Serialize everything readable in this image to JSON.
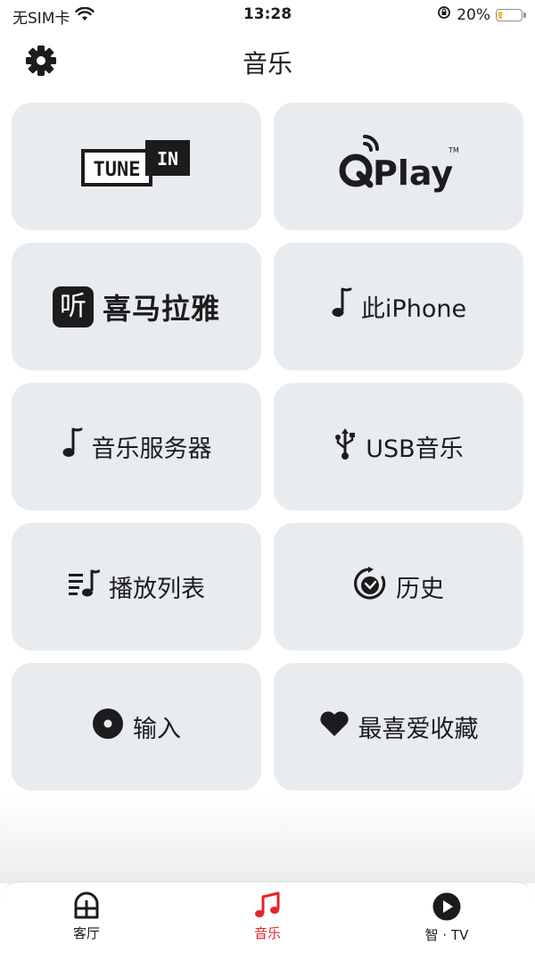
{
  "status_bar": {
    "carrier": "无SIM卡",
    "time": "13:28",
    "battery_percent": "20%",
    "battery_level": 0.2,
    "battery_color": "#f4c430"
  },
  "header": {
    "title": "音乐",
    "settings_icon": "gear-icon"
  },
  "tiles": [
    {
      "id": "tunein",
      "logo_text_left": "TUNE",
      "logo_text_right": "IN"
    },
    {
      "id": "qplay",
      "logo_text": "Play",
      "trademark": "TM"
    },
    {
      "id": "ximalaya",
      "logo_glyph": "听",
      "label": "喜马拉雅"
    },
    {
      "id": "this-iphone",
      "icon": "music-note-icon",
      "label": "此iPhone"
    },
    {
      "id": "music-server",
      "icon": "music-note-icon",
      "label": "音乐服务器"
    },
    {
      "id": "usb-music",
      "icon": "usb-icon",
      "label": "USB音乐"
    },
    {
      "id": "playlists",
      "icon": "playlist-icon",
      "label": "播放列表"
    },
    {
      "id": "history",
      "icon": "history-icon",
      "label": "历史"
    },
    {
      "id": "input",
      "icon": "disc-icon",
      "label": "输入"
    },
    {
      "id": "favorites",
      "icon": "heart-icon",
      "label": "最喜爱收藏"
    }
  ],
  "tab_bar": {
    "accent_color": "#e8222a",
    "tabs": [
      {
        "label": "客厅",
        "icon": "rooms-icon",
        "active": false
      },
      {
        "label": "音乐",
        "icon": "music-icon",
        "active": true
      },
      {
        "label": "智 · TV",
        "icon": "play-circle-icon",
        "active": false
      }
    ]
  }
}
